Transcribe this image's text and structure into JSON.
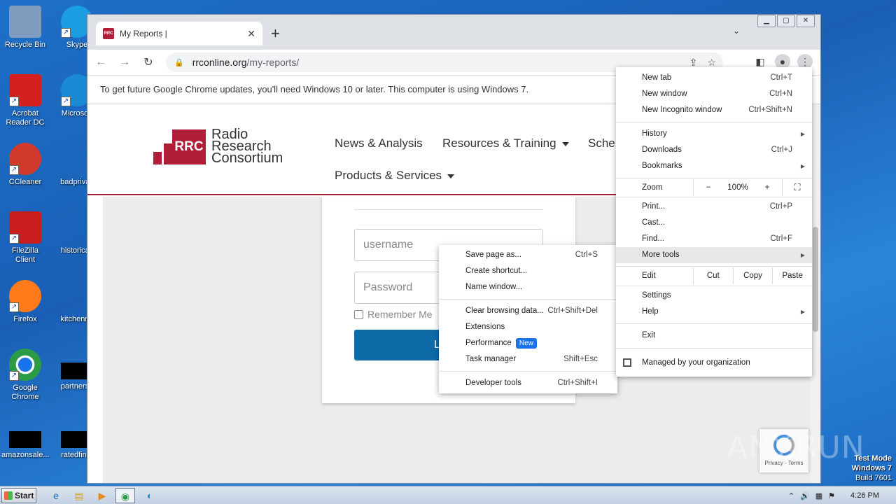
{
  "desktop": {
    "icons": [
      {
        "label": "Recycle Bin",
        "color": "#5a7fa8"
      },
      {
        "label": "Skype",
        "color": "#1b9de2"
      },
      {
        "label": "Acrobat Reader DC",
        "color": "#d61f1f"
      },
      {
        "label": "Microsoft",
        "color": "#1a8ad4"
      },
      {
        "label": "CCleaner",
        "color": "#d13a2a"
      },
      {
        "label": "badprivac",
        "color": "#ffffff"
      },
      {
        "label": "FileZilla Client",
        "color": "#c81e1e"
      },
      {
        "label": "historicalf",
        "color": "#ffffff"
      },
      {
        "label": "Firefox",
        "color": "#ff7a1a"
      },
      {
        "label": "kitchenna",
        "color": "#ffffff"
      },
      {
        "label": "Google Chrome",
        "color": "#2b9b46"
      },
      {
        "label": "partnersn",
        "color": "#000000"
      },
      {
        "label": "amazonsale...",
        "color": "#000000"
      },
      {
        "label": "ratedfinat",
        "color": "#000000"
      }
    ]
  },
  "browser": {
    "tab_title": "My Reports |",
    "favicon_text": "RRC",
    "url_domain": "rrconline.org",
    "url_path": "/my-reports/",
    "infobar": "To get future Google Chrome updates, you'll need Windows 10 or later. This computer is using Windows 7."
  },
  "site": {
    "logo_box": "RRC",
    "logo_line1": "Radio",
    "logo_line2": "Research",
    "logo_line3": "Consortium",
    "nav": {
      "news": "News & Analysis",
      "resources": "Resources & Training",
      "sche": "Sche",
      "products": "Products & Services"
    },
    "login": {
      "username_placeholder": "username",
      "password_placeholder": "Password",
      "remember": "Remember Me",
      "button": "L"
    },
    "recaptcha": "Privacy - Terms"
  },
  "menu": {
    "new_tab": {
      "label": "New tab",
      "shortcut": "Ctrl+T"
    },
    "new_window": {
      "label": "New window",
      "shortcut": "Ctrl+N"
    },
    "incognito": {
      "label": "New Incognito window",
      "shortcut": "Ctrl+Shift+N"
    },
    "history": "History",
    "downloads": {
      "label": "Downloads",
      "shortcut": "Ctrl+J"
    },
    "bookmarks": "Bookmarks",
    "zoom": {
      "label": "Zoom",
      "minus": "−",
      "value": "100%",
      "plus": "+"
    },
    "print": {
      "label": "Print...",
      "shortcut": "Ctrl+P"
    },
    "cast": "Cast...",
    "find": {
      "label": "Find...",
      "shortcut": "Ctrl+F"
    },
    "more_tools": "More tools",
    "edit": {
      "label": "Edit",
      "cut": "Cut",
      "copy": "Copy",
      "paste": "Paste"
    },
    "settings": "Settings",
    "help": "Help",
    "exit": "Exit",
    "managed": "Managed by your organization"
  },
  "submenu": {
    "save_page": {
      "label": "Save page as...",
      "shortcut": "Ctrl+S"
    },
    "create_shortcut": "Create shortcut...",
    "name_window": "Name window...",
    "clear_data": {
      "label": "Clear browsing data...",
      "shortcut": "Ctrl+Shift+Del"
    },
    "extensions": "Extensions",
    "performance": {
      "label": "Performance",
      "badge": "New"
    },
    "task_manager": {
      "label": "Task manager",
      "shortcut": "Shift+Esc"
    },
    "dev_tools": {
      "label": "Developer tools",
      "shortcut": "Ctrl+Shift+I"
    }
  },
  "taskbar": {
    "start": "Start",
    "time": "4:26 PM"
  },
  "watermark": {
    "line1": "Test Mode",
    "line2": "Windows 7",
    "line3": "Build 7601",
    "anyrun": "ANY.RUN"
  }
}
